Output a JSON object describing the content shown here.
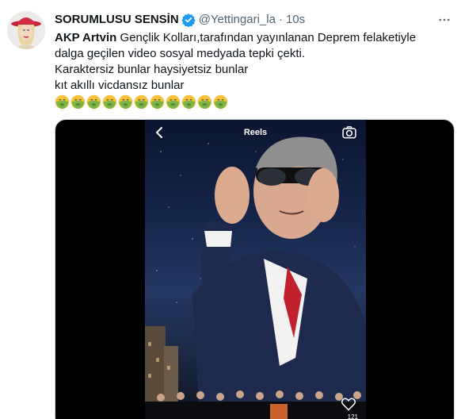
{
  "tweet": {
    "display_name": "SORUMLUSU SENSİN",
    "handle": "@Yettingari_la",
    "separator": "·",
    "time": "10s",
    "text_bold": "AKP Artvin",
    "text_line1": " Gençlik Kolları,tarafından yayınlanan Deprem felaketiyle",
    "text_line2": "dalga geçilen video sosyal medyada tepki çekti.",
    "text_line3": "Karaktersiz bunlar haysiyetsiz bunlar",
    "text_line4": "kıt akıllı vicdansız bunlar",
    "emoji_count": 11,
    "emoji_name": "nauseated-face-icon"
  },
  "video": {
    "title": "Reels",
    "like_count": "121"
  },
  "colors": {
    "text": "#0f1419",
    "secondary": "#536471",
    "verified": "#1d9bf0",
    "emoji_green": "#7ab648",
    "emoji_face": "#f6c33b"
  }
}
